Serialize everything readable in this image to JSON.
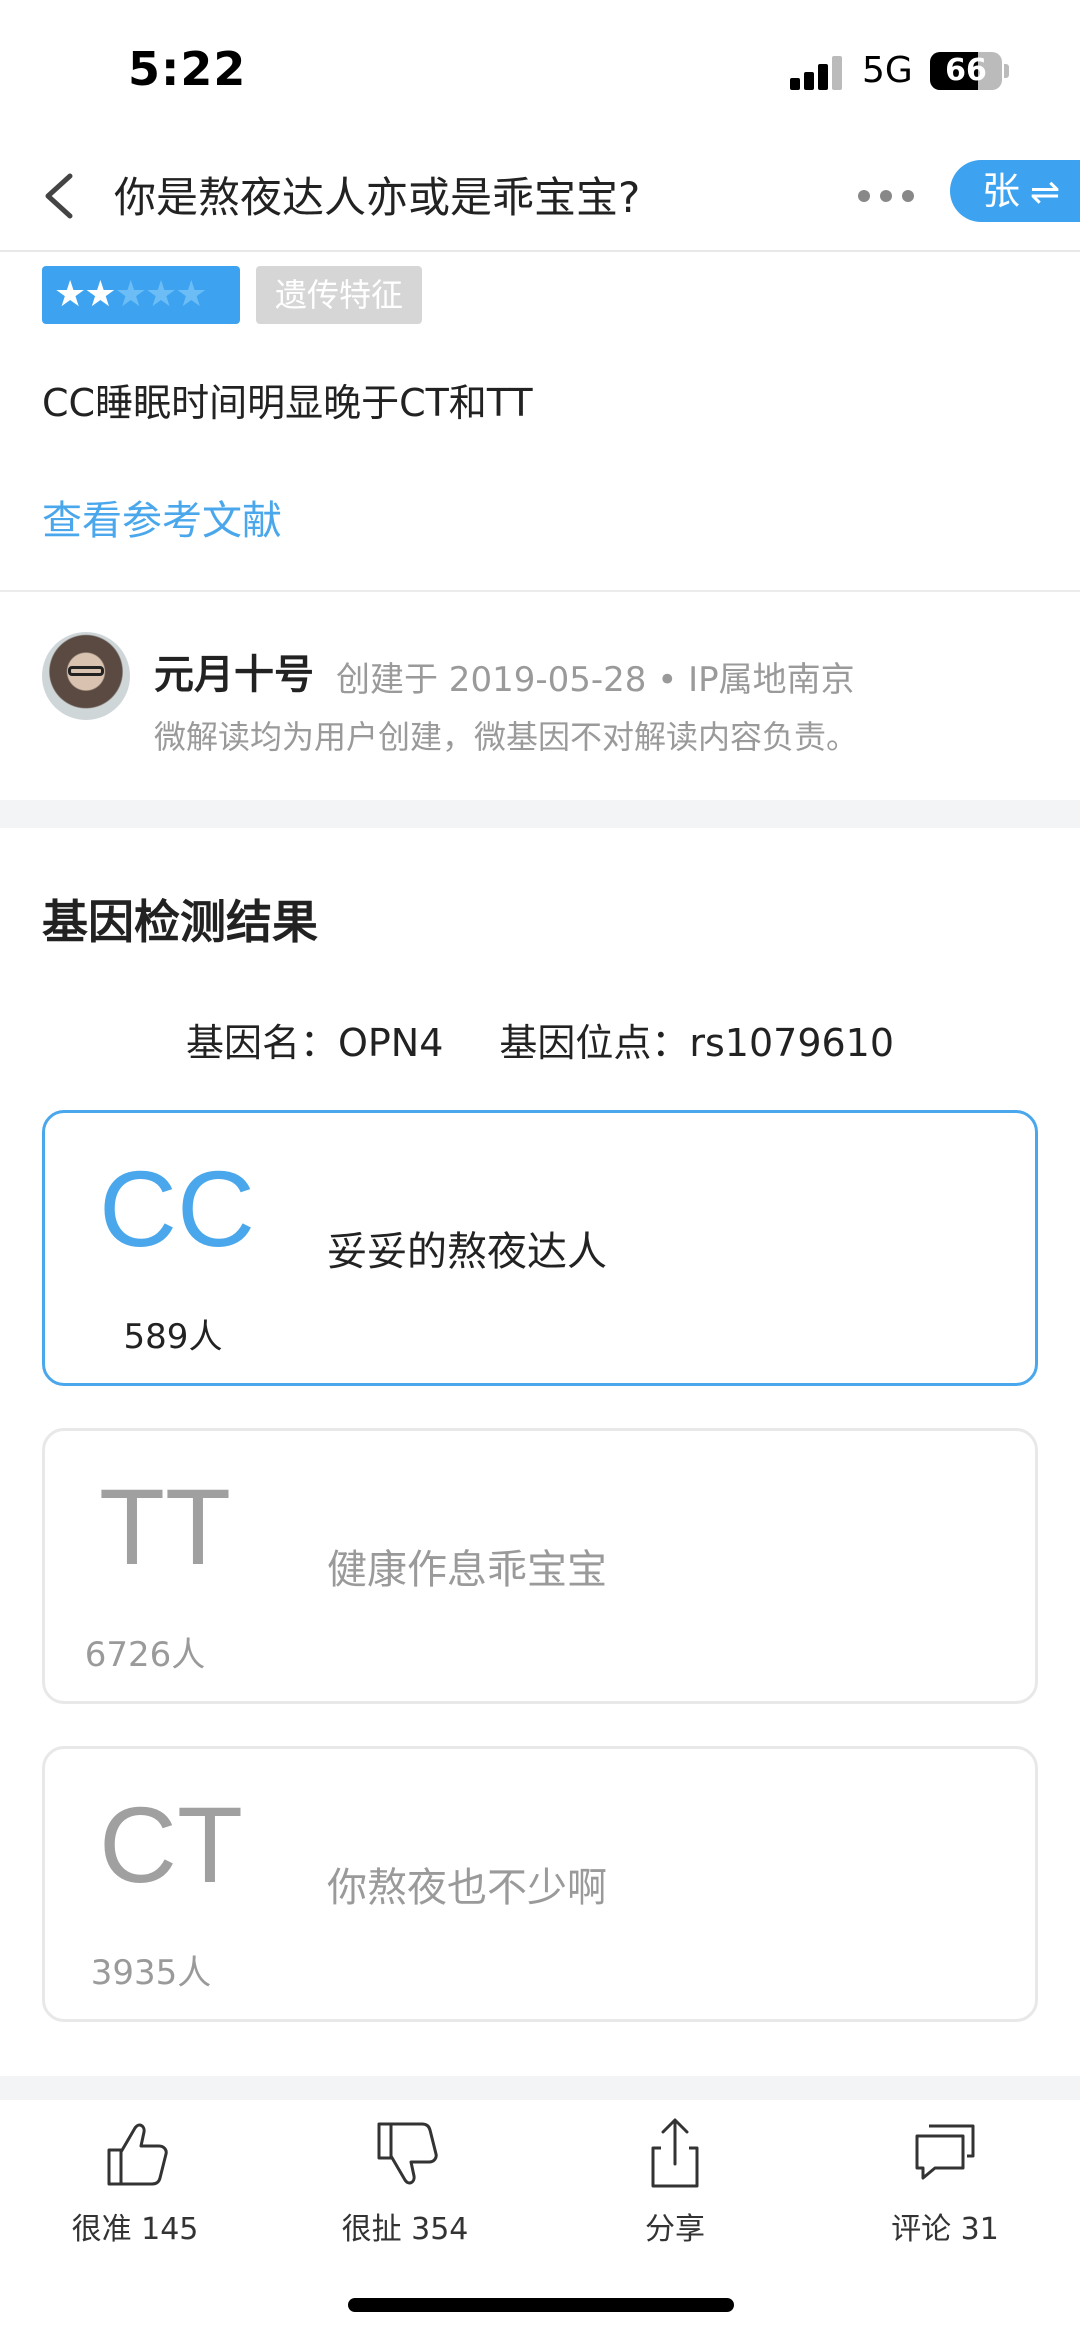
{
  "status_bar": {
    "time": "5:22",
    "network": "5G",
    "battery": "66",
    "battery_level": 0.66
  },
  "nav": {
    "title": "你是熬夜达人亦或是乖宝宝?",
    "pill_label": "张",
    "pill_icon": "⇌"
  },
  "rating": {
    "stars_filled": 2,
    "stars_total": 5
  },
  "tag": "遗传特征",
  "result_description": "CC睡眠时间明显晚于CT和TT",
  "reference_link": "查看参考文献",
  "author": {
    "name": "元月十号",
    "meta": "创建于 2019-05-28 • IP属地南京",
    "disclaimer": "微解读均为用户创建，微基因不对解读内容负责。"
  },
  "section": {
    "title": "基因检测结果",
    "gene_name": "基因名：OPN4",
    "gene_locus": "基因位点：rs1079610"
  },
  "genotypes": [
    {
      "genotype": "CC",
      "count": "589人",
      "label": "妥妥的熬夜达人",
      "selected": true
    },
    {
      "genotype": "TT",
      "count": "6726人",
      "label": "健康作息乖宝宝",
      "selected": false
    },
    {
      "genotype": "CT",
      "count": "3935人",
      "label": "你熬夜也不少啊",
      "selected": false
    }
  ],
  "bottom_bar": {
    "accurate": "很准 145",
    "nonsense": "很扯 354",
    "share": "分享",
    "comments": "评论 31"
  },
  "colors": {
    "accent": "#3da3f0",
    "link": "#4aa7ec",
    "muted": "#9a9a9a"
  }
}
